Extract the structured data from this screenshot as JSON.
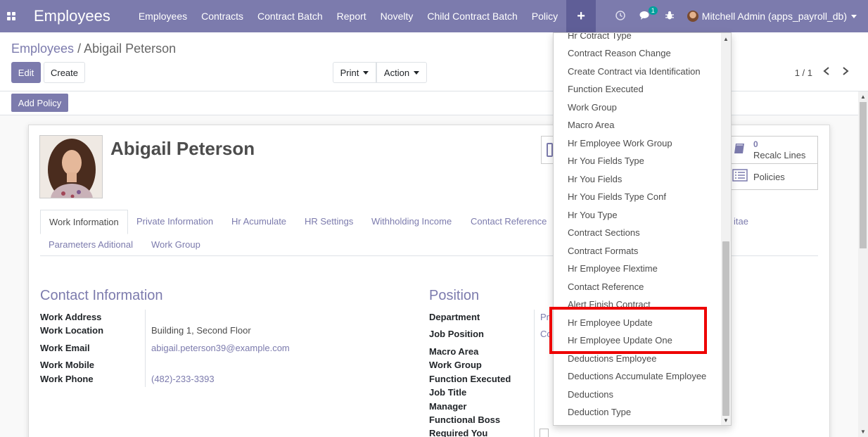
{
  "navbar": {
    "brand": "Employees",
    "menu": [
      "Employees",
      "Contracts",
      "Contract Batch",
      "Report",
      "Novelty",
      "Child Contract Batch",
      "Policy"
    ],
    "plus": "+",
    "chat_count": "1",
    "user": "Mitchell Admin (apps_payroll_db)"
  },
  "breadcrumb": {
    "parent": "Employees",
    "separator": "/",
    "current": "Abigail Peterson"
  },
  "buttons": {
    "edit": "Edit",
    "create": "Create",
    "print": "Print",
    "action": "Action",
    "add_policy": "Add Policy"
  },
  "pager": {
    "value": "1 / 1"
  },
  "employee": {
    "name": "Abigail Peterson"
  },
  "smart_buttons": [
    {
      "count": "0",
      "label": "Recalc Lines"
    },
    {
      "label": "Policies"
    }
  ],
  "tabs": [
    "Work Information",
    "Private Information",
    "Hr Acumulate",
    "HR Settings",
    "Withholding Income",
    "Contact Reference",
    "itae",
    "Parameters Aditional",
    "Work Group"
  ],
  "contact": {
    "title": "Contact Information",
    "fields": [
      {
        "label": "Work Address",
        "value": ""
      },
      {
        "label": "Work Location",
        "value": "Building 1, Second Floor"
      },
      {
        "label": "Work Email",
        "value": "abigail.peterson39@example.com"
      },
      {
        "label": "Work Mobile",
        "value": ""
      },
      {
        "label": "Work Phone",
        "value": "(482)-233-3393"
      }
    ]
  },
  "position": {
    "title": "Position",
    "fields": [
      "Department",
      "Job Position",
      "Macro Area",
      "Work Group",
      "Function Executed",
      "Job Title",
      "Manager",
      "Functional Boss",
      "Required You"
    ],
    "partial_values": [
      "Pr",
      "Co"
    ]
  },
  "dropdown": {
    "items": [
      "Hr Cotract Type",
      "Contract Reason Change",
      "Create Contract via Identification",
      "Function Executed",
      "Work Group",
      "Macro Area",
      "Hr Employee Work Group",
      "Hr You Fields Type",
      "Hr You Fields",
      "Hr You Fields Type Conf",
      "Hr You Type",
      "Contract Sections",
      "Contract Formats",
      "Hr Employee Flextime",
      "Contact Reference",
      "Alert Finish Contract",
      "Hr Employee Update",
      "Hr Employee Update One",
      "Deductions Employee",
      "Deductions Accumulate Employee",
      "Deductions",
      "Deduction Type"
    ]
  },
  "colors": {
    "primary": "#7c7bad",
    "highlight": "#ee0000"
  }
}
